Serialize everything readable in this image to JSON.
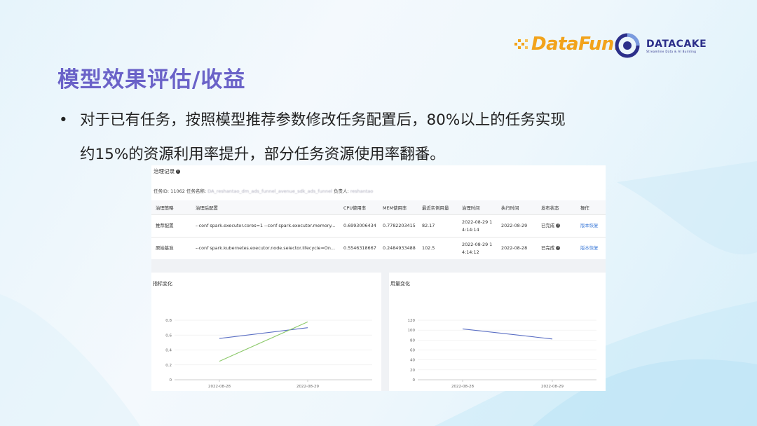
{
  "slide": {
    "title": "模型效果评估/收益",
    "bullet_symbol": "•",
    "bullet_line1": "对于已有任务，按照模型推荐参数修改任务配置后，80%以上的任务实现",
    "bullet_line2": "约15%的资源利用率提升，部分任务资源使用率翻番。"
  },
  "logos": {
    "datafun_text": "DataFun.",
    "datacake_text": "DATACAKE",
    "datacake_tagline": "Streamline Data & AI Building"
  },
  "record_panel": {
    "title": "治理记录",
    "info_icon": "i",
    "task_label": "任务ID: 11062 任务名称:",
    "task_name_blurred": "DA_reshantao_dm_ads_funnel_avenue_sdk_ads_funnel",
    "owner_label": "负责人:",
    "owner_blurred": "reshantao",
    "columns": [
      "治理策略",
      "治理后配置",
      "CPU使用率",
      "MEM使用率",
      "最近实例用量",
      "治理时间",
      "执行时间",
      "发布状态",
      "操作"
    ],
    "rows": [
      {
        "strategy": "推荐配置",
        "config": "--conf spark.executor.cores=1 --conf spark.executor.memory...",
        "cpu": "0.6993006434",
        "mem": "0.7782203415",
        "usage": "82.17",
        "gov_time_1": "2022-08-29 1",
        "gov_time_2": "4:14:14",
        "exec_time": "2022-08-29",
        "status": "已完成",
        "action": "版本恢复"
      },
      {
        "strategy": "原始基准",
        "config": "--conf spark.kubernetes.executor.node.selector.lifecycle=On...",
        "cpu": "0.5546318667",
        "mem": "0.2484933488",
        "usage": "102.5",
        "gov_time_1": "2022-08-29 1",
        "gov_time_2": "4:14:12",
        "exec_time": "2022-08-28",
        "status": "已完成",
        "action": "版本恢复"
      }
    ]
  },
  "charts": {
    "left_title": "指标变化",
    "right_title": "用量变化",
    "colors": {
      "series_a": "#5b6fc4",
      "series_b": "#8cc96a",
      "axis": "#bbbbbb",
      "grid": "#eeeeee"
    }
  },
  "chart_data": [
    {
      "type": "line",
      "title": "指标变化",
      "categories": [
        "2022-08-28",
        "2022-08-29"
      ],
      "ylim": [
        0,
        0.8
      ],
      "yticks": [
        "0",
        "0.2",
        "0.4",
        "0.6",
        "0.8"
      ],
      "series": [
        {
          "values": [
            0.5546,
            0.6993
          ]
        },
        {
          "values": [
            0.2485,
            0.7782
          ]
        }
      ]
    },
    {
      "type": "line",
      "title": "用量变化",
      "categories": [
        "2022-08-28",
        "2022-08-29"
      ],
      "ylim": [
        0,
        120
      ],
      "yticks": [
        "0",
        "20",
        "40",
        "60",
        "80",
        "100",
        "120"
      ],
      "series": [
        {
          "values": [
            102.5,
            82.17
          ]
        }
      ]
    }
  ]
}
